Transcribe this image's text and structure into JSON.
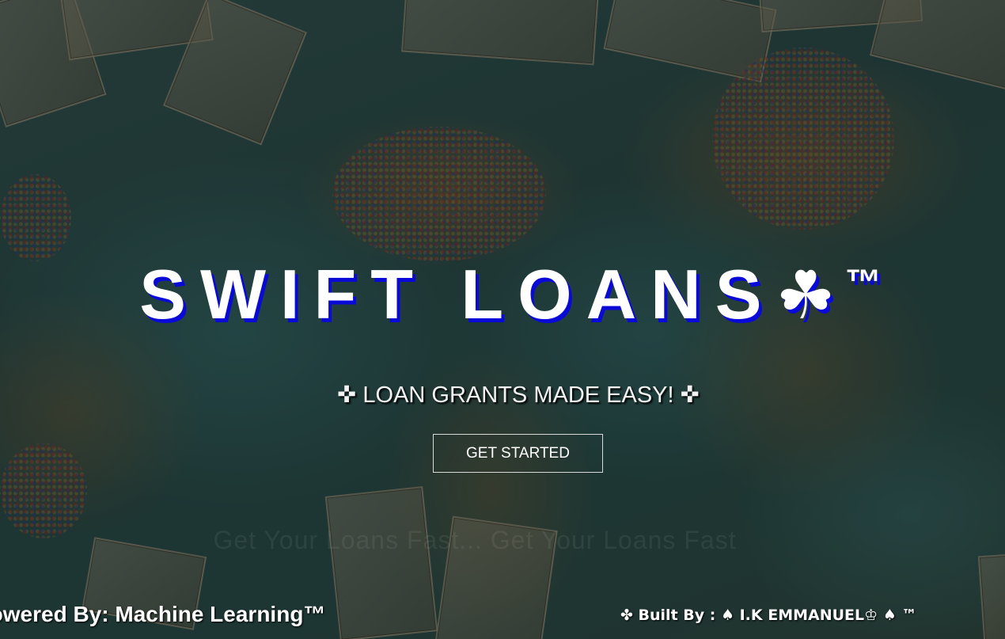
{
  "hero": {
    "title": "SWIFT LOANS",
    "title_symbol": "☘",
    "title_trademark": "™",
    "tagline": "✜ LOAN GRANTS MADE EASY! ✜",
    "cta_label": "GET STARTED",
    "faded_text": "Get Your Loans Fast... Get Your Loans Fast"
  },
  "footer": {
    "powered_by": "Powered By: Machine Learning™",
    "built_by": "✤ Built By : ♠ I.K EMMANUEL♔ ♠ ™"
  },
  "colors": {
    "title_shadow": "#0a0ad8",
    "text": "#ffffff",
    "button_border": "#d9d9d9"
  }
}
